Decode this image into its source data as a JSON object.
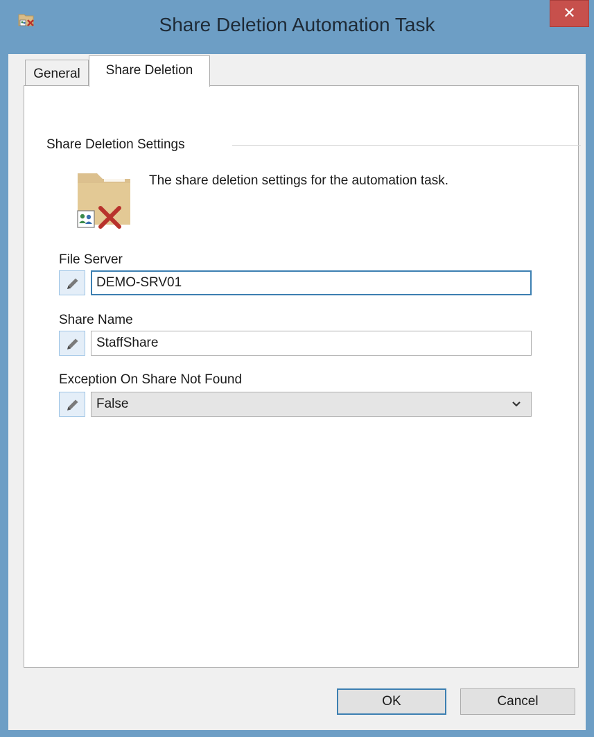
{
  "window": {
    "title": "Share Deletion Automation Task",
    "close_label": "✕"
  },
  "tabs": [
    {
      "label": "General",
      "active": false
    },
    {
      "label": "Share Deletion",
      "active": true
    }
  ],
  "group": {
    "title": "Share Deletion Settings",
    "description": "The share deletion settings for the automation task."
  },
  "fields": {
    "file_server": {
      "label": "File Server",
      "value": "DEMO-SRV01"
    },
    "share_name": {
      "label": "Share Name",
      "value": "StaffShare"
    },
    "exception_on_not_found": {
      "label": "Exception On Share Not Found",
      "value": "False"
    }
  },
  "buttons": {
    "ok": "OK",
    "cancel": "Cancel"
  },
  "icons": {
    "app": "share-delete-icon",
    "settings": "folder-delete-icon",
    "edit": "pencil-icon",
    "dropdown": "chevron-down-icon"
  },
  "colors": {
    "titlebar": "#6d9ec5",
    "close": "#c7504c",
    "focus_border": "#3c7fb1",
    "folder": "#dcc08e",
    "delete_x": "#b8322c"
  }
}
